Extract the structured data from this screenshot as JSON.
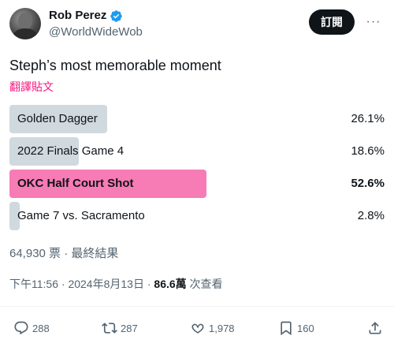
{
  "author": {
    "display_name": "Rob Perez",
    "handle": "@WorldWideWob",
    "verified": true
  },
  "header": {
    "subscribe_label": "訂閱",
    "more_label": "···"
  },
  "tweet": {
    "text": "Steph’s most memorable moment",
    "translate_label": "翻譯貼文"
  },
  "poll": {
    "options": [
      {
        "label": "Golden Dagger",
        "percent": 26.1,
        "percent_label": "26.1%",
        "winner": false
      },
      {
        "label": "2022 Finals Game 4",
        "percent": 18.6,
        "percent_label": "18.6%",
        "winner": false
      },
      {
        "label": "OKC Half Court Shot",
        "percent": 52.6,
        "percent_label": "52.6%",
        "winner": true
      },
      {
        "label": "Game 7 vs. Sacramento",
        "percent": 2.8,
        "percent_label": "2.8%",
        "winner": false
      }
    ],
    "summary": "64,930 票 · 最終結果"
  },
  "meta": {
    "time": "下午11:56",
    "sep1": " · ",
    "date": "2024年8月13日",
    "sep2": " · ",
    "views_count": "86.6萬",
    "views_label": " 次查看"
  },
  "actions": {
    "reply_count": "288",
    "retweet_count": "287",
    "like_count": "1,978",
    "bookmark_count": "160"
  },
  "colors": {
    "accent_pink": "#f91880",
    "winner_bar": "#f77bb5",
    "bar": "#cfd9de",
    "verified_blue": "#1d9bf0"
  }
}
